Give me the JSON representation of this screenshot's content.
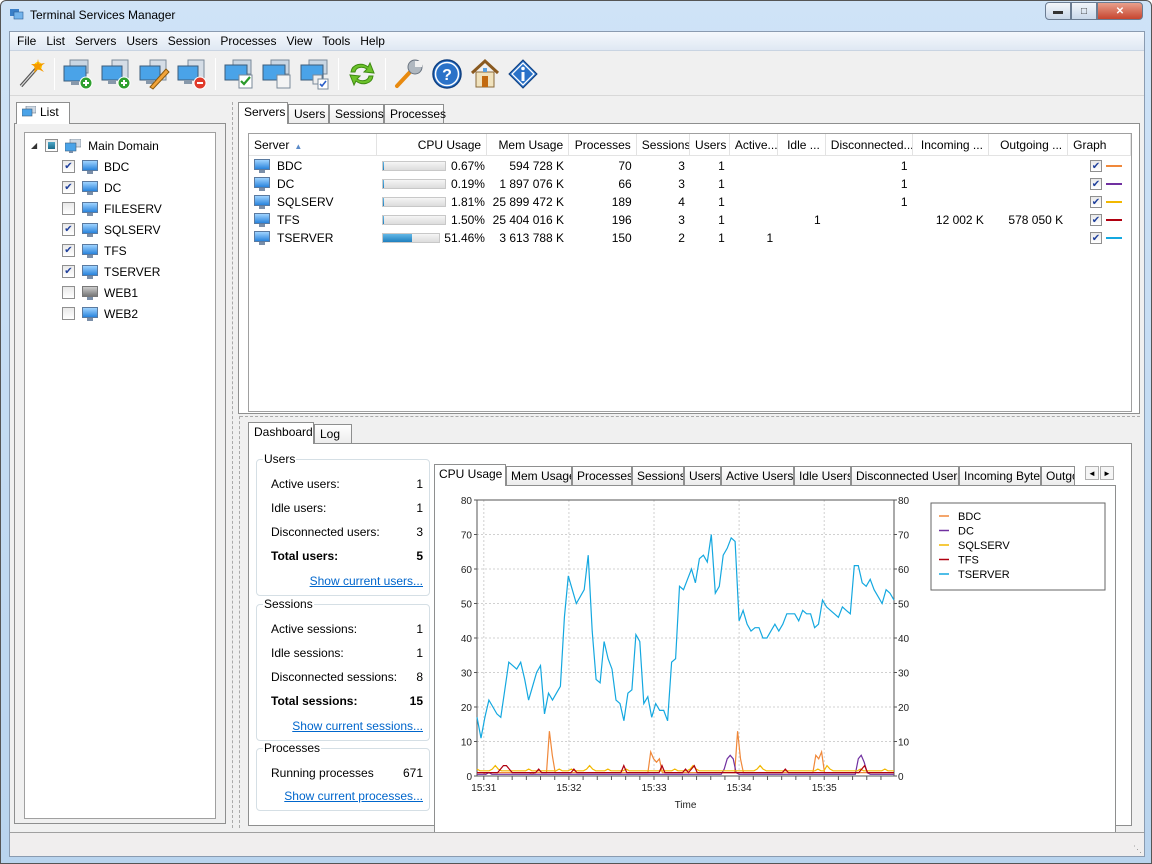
{
  "window": {
    "title": "Terminal Services Manager",
    "controls": [
      "minimize",
      "maximize",
      "close"
    ]
  },
  "menubar": [
    "File",
    "List",
    "Servers",
    "Users",
    "Session",
    "Processes",
    "View",
    "Tools",
    "Help"
  ],
  "toolbar": {
    "buttons": [
      {
        "icon": "wizard-wand-icon",
        "tooltip": ""
      },
      {
        "icon": "add-server-icon"
      },
      {
        "icon": "add-server-group-icon"
      },
      {
        "icon": "edit-server-icon"
      },
      {
        "icon": "remove-server-icon"
      },
      {
        "icon": "select-all-servers-icon"
      },
      {
        "icon": "deselect-servers-icon"
      },
      {
        "icon": "invert-selection-icon"
      },
      {
        "icon": "refresh-icon"
      },
      {
        "icon": "settings-wrench-icon"
      },
      {
        "icon": "help-icon"
      },
      {
        "icon": "home-icon"
      },
      {
        "icon": "info-icon"
      }
    ]
  },
  "left_panel": {
    "tab": "List",
    "root": {
      "label": "Main Domain",
      "state": "partial",
      "expanded": true
    },
    "servers": [
      {
        "name": "BDC",
        "checked": true,
        "online": true
      },
      {
        "name": "DC",
        "checked": true,
        "online": true
      },
      {
        "name": "FILESERV",
        "checked": false,
        "online": true
      },
      {
        "name": "SQLSERV",
        "checked": true,
        "online": true
      },
      {
        "name": "TFS",
        "checked": true,
        "online": true
      },
      {
        "name": "TSERVER",
        "checked": true,
        "online": true
      },
      {
        "name": "WEB1",
        "checked": false,
        "online": false
      },
      {
        "name": "WEB2",
        "checked": false,
        "online": true
      }
    ]
  },
  "top_tabs": [
    "Servers",
    "Users",
    "Sessions",
    "Processes"
  ],
  "top_active_tab": "Servers",
  "servers_table": {
    "columns": [
      "Server",
      "CPU Usage",
      "Mem Usage",
      "Processes",
      "Sessions",
      "Users",
      "Active...",
      "Idle ...",
      "Disconnected...",
      "Incoming ...",
      "Outgoing ...",
      "Graph"
    ],
    "sort_column": "Server",
    "sort_direction": "ascending",
    "rows": [
      {
        "server": "BDC",
        "cpu_pct": 0.67,
        "cpu": "0.67%",
        "mem": "594 728 K",
        "processes": "70",
        "sessions": "3",
        "users": "1",
        "active": "",
        "idle": "",
        "disconnected": "1",
        "incoming": "",
        "outgoing": "",
        "graph": true,
        "color": "#f0883a"
      },
      {
        "server": "DC",
        "cpu_pct": 0.19,
        "cpu": "0.19%",
        "mem": "1 897 076 K",
        "processes": "66",
        "sessions": "3",
        "users": "1",
        "active": "",
        "idle": "",
        "disconnected": "1",
        "incoming": "",
        "outgoing": "",
        "graph": true,
        "color": "#7030a0"
      },
      {
        "server": "SQLSERV",
        "cpu_pct": 1.81,
        "cpu": "1.81%",
        "mem": "25 899 472 K",
        "processes": "189",
        "sessions": "4",
        "users": "1",
        "active": "",
        "idle": "",
        "disconnected": "1",
        "incoming": "",
        "outgoing": "",
        "graph": true,
        "color": "#f2b800"
      },
      {
        "server": "TFS",
        "cpu_pct": 1.5,
        "cpu": "1.50%",
        "mem": "25 404 016 K",
        "processes": "196",
        "sessions": "3",
        "users": "1",
        "active": "",
        "idle": "1",
        "disconnected": "",
        "incoming": "12 002 K",
        "outgoing": "578 050 K",
        "graph": true,
        "color": "#b00010"
      },
      {
        "server": "TSERVER",
        "cpu_pct": 51.46,
        "cpu": "51.46%",
        "mem": "3 613 788 K",
        "processes": "150",
        "sessions": "2",
        "users": "1",
        "active": "1",
        "idle": "",
        "disconnected": "",
        "incoming": "",
        "outgoing": "",
        "graph": true,
        "color": "#14a8e0"
      }
    ]
  },
  "bottom_tabs": [
    "Dashboard",
    "Log"
  ],
  "bottom_active_tab": "Dashboard",
  "dashboard": {
    "users": {
      "title": "Users",
      "rows": [
        {
          "label": "Active users:",
          "value": "1"
        },
        {
          "label": "Idle users:",
          "value": "1"
        },
        {
          "label": "Disconnected users:",
          "value": "3"
        }
      ],
      "total": {
        "label": "Total users:",
        "value": "5"
      },
      "link": "Show current users..."
    },
    "sessions": {
      "title": "Sessions",
      "rows": [
        {
          "label": "Active sessions:",
          "value": "1"
        },
        {
          "label": "Idle sessions:",
          "value": "1"
        },
        {
          "label": "Disconnected sessions:",
          "value": "8"
        }
      ],
      "total": {
        "label": "Total sessions:",
        "value": "15"
      },
      "link": "Show current sessions..."
    },
    "processes": {
      "title": "Processes",
      "rows": [
        {
          "label": "Running processes",
          "value": "671"
        }
      ],
      "link": "Show current processes..."
    }
  },
  "chart_tabs": [
    "CPU Usage",
    "Mem Usage",
    "Processes",
    "Sessions",
    "Users",
    "Active Users",
    "Idle Users",
    "Disconnected Users",
    "Incoming Bytes",
    "Outgoing Bytes"
  ],
  "chart_active_tab": "CPU Usage",
  "chart_data": {
    "type": "line",
    "title": "",
    "xlabel": "Time",
    "ylabel": "",
    "ylim": [
      0,
      80
    ],
    "yticks": [
      0,
      10,
      20,
      30,
      40,
      50,
      60,
      70,
      80
    ],
    "xlim_minutes": [
      30.92,
      35.82
    ],
    "xticks": [
      {
        "t": 31,
        "label": "15:31"
      },
      {
        "t": 32,
        "label": "15:32"
      },
      {
        "t": 33,
        "label": "15:33"
      },
      {
        "t": 34,
        "label": "15:34"
      },
      {
        "t": 35,
        "label": "15:35"
      }
    ],
    "grid": true,
    "legend_position": "top-right",
    "legend": [
      "BDC",
      "DC",
      "SQLSERV",
      "TFS",
      "TSERVER"
    ],
    "sample_interval_sec": 2.5,
    "series": [
      {
        "name": "BDC",
        "color": "#f0883a",
        "values": [
          1,
          1,
          1,
          0.5,
          1,
          1,
          1,
          1,
          1,
          1,
          1,
          1,
          1,
          1,
          1,
          1,
          1,
          1,
          1,
          0.5,
          1,
          1,
          1,
          1,
          1,
          13,
          6,
          1,
          1,
          1,
          1,
          1,
          1,
          1,
          1,
          1,
          1,
          1,
          1,
          1,
          1,
          1,
          1,
          1,
          1,
          1,
          1,
          1,
          1,
          1,
          1,
          1,
          1,
          1,
          1,
          1,
          1,
          1,
          1,
          1,
          7,
          5,
          4,
          5,
          1,
          1,
          1,
          1,
          1,
          1,
          1,
          1,
          1,
          1,
          1,
          1,
          1,
          1,
          1,
          1,
          1,
          1,
          1,
          1,
          1,
          1,
          1,
          1,
          1,
          1,
          13,
          5,
          1,
          1,
          1,
          1,
          1,
          1,
          1,
          1,
          1,
          1,
          1,
          1,
          1,
          1,
          1,
          1,
          1,
          1,
          1,
          1,
          1,
          1,
          1,
          1,
          1,
          6,
          5,
          7,
          1,
          1,
          1,
          1,
          1,
          1,
          1,
          1,
          1,
          1,
          1,
          1,
          1,
          1,
          1,
          1,
          1,
          1,
          1,
          1,
          1,
          1,
          1,
          1,
          1
        ]
      },
      {
        "name": "DC",
        "color": "#7030a0",
        "values": [
          0.5,
          0.5,
          0.5,
          0.5,
          1,
          0.5,
          0.5,
          0.5,
          0.5,
          0.5,
          0.5,
          0.5,
          0.5,
          0.5,
          0.5,
          0.5,
          0.5,
          0.5,
          0.5,
          0.5,
          0.5,
          0.5,
          0.5,
          0.5,
          0.5,
          0.5,
          0.5,
          0.5,
          0.5,
          0.5,
          0.5,
          0.5,
          0.5,
          0.5,
          0.5,
          0.5,
          0.5,
          0.5,
          0.5,
          0.5,
          0.5,
          0.5,
          0.5,
          0.5,
          0.5,
          0.5,
          0.5,
          0.5,
          0.5,
          0.5,
          0.5,
          0.5,
          0.5,
          0.5,
          0.5,
          0.5,
          0.5,
          0.5,
          0.5,
          0.5,
          0.5,
          0.5,
          0.5,
          0.5,
          0.5,
          0.5,
          0.5,
          0.5,
          0.5,
          0.5,
          0.5,
          0.5,
          0.5,
          0.5,
          0.5,
          0.5,
          0.5,
          0.5,
          0.5,
          0.5,
          0.5,
          0.5,
          0.5,
          2,
          5,
          6,
          5,
          1,
          0.5,
          0.5,
          0.5,
          0.5,
          0.5,
          0.5,
          0.5,
          0.5,
          0.5,
          0.5,
          0.5,
          0.5,
          0.5,
          0.5,
          0.5,
          0.5,
          0.5,
          0.5,
          0.5,
          0.5,
          0.5,
          0.5,
          0.5,
          0.5,
          0.5,
          0.5,
          0.5,
          0.5,
          0.5,
          0.5,
          0.5,
          0.5,
          0.5,
          0.5,
          0.5,
          0.5,
          0.5,
          0.5,
          0.5,
          0.5,
          5,
          6,
          4,
          1,
          0.5,
          0.5,
          0.5,
          0.5,
          0.5,
          0.5,
          0.5,
          0.5,
          0.5
        ]
      },
      {
        "name": "SQLSERV",
        "color": "#f2b800",
        "values": [
          2,
          1.5,
          1.5,
          1.5,
          1.5,
          2,
          3,
          2,
          1.5,
          1.5,
          1.5,
          1.5,
          1.5,
          1.5,
          1.5,
          1.5,
          1.5,
          2,
          1.5,
          1.5,
          1.5,
          1.5,
          1.5,
          1.5,
          1.5,
          1.5,
          1.5,
          2,
          1.5,
          1.5,
          1.5,
          2,
          1.5,
          1.5,
          1.5,
          1.5,
          2,
          3,
          2,
          1.5,
          1.5,
          1.5,
          1.5,
          2,
          1.5,
          1.5,
          1.5,
          1.5,
          1.5,
          2,
          1.5,
          1.5,
          1.5,
          1.5,
          1.5,
          1.5,
          1.5,
          1.5,
          1.5,
          1.5,
          1.5,
          1.5,
          1.5,
          1.5,
          1.5,
          2,
          1.5,
          1.5,
          1.5,
          1.5,
          2,
          3,
          2,
          1.5,
          1.5,
          1.5,
          1.5,
          1.5,
          1.5,
          1.5,
          1.5,
          1.5,
          1.5,
          1.5,
          1.5,
          1.5,
          1.5,
          1.5,
          1.5,
          1.5,
          1.5,
          1.5,
          2,
          3,
          2,
          1.5,
          1.5,
          1.5,
          1.5,
          1.5,
          1.5,
          1.5,
          1.5,
          1.5,
          1.5,
          1.5,
          1.5,
          1.5,
          1.5,
          1.5,
          1.5,
          1.5,
          2,
          1.5,
          1.5,
          3,
          2,
          1.5,
          1.5,
          1.5,
          1.5,
          1.5,
          1.5,
          1.5,
          1.5,
          1.5,
          2,
          1.5,
          1.5,
          1.5,
          1.5,
          1.5,
          1.5,
          1.5,
          2,
          1.5,
          1.5,
          1.5
        ]
      },
      {
        "name": "TFS",
        "color": "#b00010",
        "values": [
          1,
          1,
          1,
          1,
          1,
          1,
          1,
          1,
          2,
          3,
          3,
          2,
          1,
          1,
          1,
          1,
          1,
          1,
          1,
          1,
          1,
          2,
          1,
          1,
          1,
          1,
          1,
          1,
          1,
          1,
          1,
          1,
          1,
          2,
          1,
          1,
          1,
          1,
          1,
          1,
          1,
          1,
          1,
          1,
          1,
          1,
          1,
          1,
          1,
          1,
          3,
          1,
          1,
          1,
          1,
          1,
          1,
          1,
          1,
          1,
          1,
          1,
          1,
          3,
          1,
          1,
          1,
          1,
          1,
          1,
          1,
          2,
          1,
          2,
          3,
          1,
          1,
          1,
          1,
          1,
          1,
          1,
          1,
          1,
          1,
          1,
          1,
          1,
          1,
          1,
          1,
          1,
          1,
          1,
          1,
          1,
          1,
          1,
          1,
          1,
          1,
          1,
          1,
          1,
          1,
          2,
          1,
          1,
          1,
          1,
          1,
          1,
          1,
          1,
          1,
          1,
          1,
          1,
          1,
          1,
          1,
          1,
          1,
          1,
          1,
          1,
          1,
          1,
          1,
          1,
          1,
          2,
          3,
          1,
          1,
          1,
          1,
          1,
          1,
          1,
          1,
          1,
          1
        ]
      },
      {
        "name": "TSERVER",
        "color": "#14a8e0",
        "values": [
          17,
          11,
          17,
          22,
          20,
          18,
          17,
          25,
          33,
          32,
          31,
          33,
          28,
          22,
          26,
          30,
          32,
          18,
          24,
          22,
          24,
          26,
          46,
          58,
          54,
          50,
          52,
          54,
          64,
          42,
          28,
          27,
          39,
          34,
          31,
          22,
          21,
          16,
          24,
          25,
          41,
          39,
          21,
          23,
          17,
          21,
          19,
          19,
          16,
          33,
          34,
          55,
          54,
          57,
          60,
          56,
          63,
          64,
          62,
          70,
          53,
          55,
          64,
          66,
          69,
          68,
          45,
          48,
          44,
          42,
          43,
          43,
          40,
          40,
          42,
          44,
          42,
          44,
          47,
          47,
          47,
          45,
          48,
          47,
          47,
          43,
          44,
          51,
          49,
          48,
          47,
          46,
          49,
          48,
          47,
          61,
          61,
          56,
          55,
          57,
          54,
          52,
          50,
          54,
          53,
          51
        ]
      }
    ]
  },
  "statusbar": {
    "text": ""
  }
}
